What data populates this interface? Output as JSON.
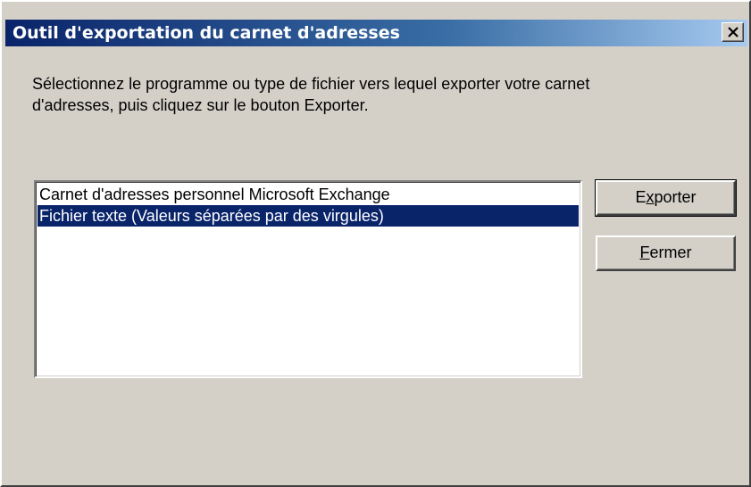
{
  "window": {
    "title": "Outil d'exportation du carnet d'adresses",
    "close_icon": "close-icon"
  },
  "prompt": {
    "line1": "Sélectionnez le programme ou type de fichier vers lequel exporter votre carnet",
    "line2": "d'adresses, puis cliquez sur le bouton Exporter."
  },
  "list": {
    "items": [
      {
        "label": "Carnet d'adresses personnel Microsoft Exchange",
        "selected": false
      },
      {
        "label": "Fichier texte (Valeurs séparées par des virgules)",
        "selected": true
      }
    ]
  },
  "buttons": {
    "export": {
      "before": "E",
      "mnemonic": "x",
      "after": "porter"
    },
    "close": {
      "before": "",
      "mnemonic": "F",
      "after": "ermer"
    }
  },
  "colors": {
    "face": "#d4d0c8",
    "selection": "#0a246a",
    "titlebar_start": "#0a246a",
    "titlebar_end": "#a6caf0"
  }
}
